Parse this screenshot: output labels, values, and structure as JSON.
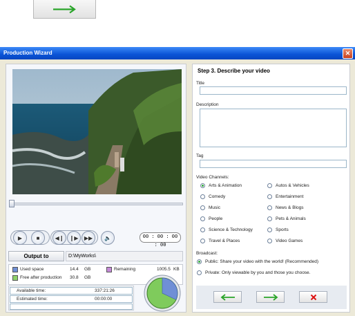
{
  "window": {
    "title": "Production Wizard",
    "close_glyph": "✕"
  },
  "step": {
    "heading": "Step 3. Describe your video"
  },
  "form": {
    "title_label": "Title",
    "title_value": "",
    "description_label": "Description",
    "description_value": "",
    "tag_label": "Tag",
    "tag_value": "",
    "channels_label": "Video Channels:",
    "channels": [
      "Arts & Animation",
      "Autos & Vehicles",
      "Comedy",
      "Entertainment",
      "Music",
      "News & Blogs",
      "People",
      "Pets & Animals",
      "Science & Technology",
      "Sports",
      "Travel & Places",
      "Video Games"
    ],
    "selected_channel": "Arts & Animation",
    "broadcast_label": "Broadcast:",
    "broadcast_public": "Public: Share your video with the world! (Recommended)",
    "broadcast_private": "Private: Only viewable by you and those you choose.",
    "selected_broadcast": "public"
  },
  "player": {
    "timecode": "00 : 00 : 00 : 00"
  },
  "output": {
    "button_label": "Output to",
    "path": "D:\\MyWorks\\"
  },
  "disk": {
    "used_label": "Used space",
    "used_value": "14.4",
    "free_label": "Free after production",
    "free_value": "30.8",
    "unit": "GB",
    "remaining_label": "Remaining",
    "remaining_value": "1005.5",
    "remaining_unit": "KB",
    "used_fraction": 0.32,
    "colors": {
      "used": "#6f8fd6",
      "free": "#8fd26a",
      "remaining": "#c58ad8"
    }
  },
  "time": {
    "available_label": "Available time:",
    "available_value": "337:21:26",
    "estimated_label": "Estimated time:",
    "estimated_value": "00:00:00"
  },
  "icons": {
    "next_arrow": "arrow-right-icon",
    "back_arrow": "arrow-left-icon",
    "cancel": "x-icon"
  }
}
